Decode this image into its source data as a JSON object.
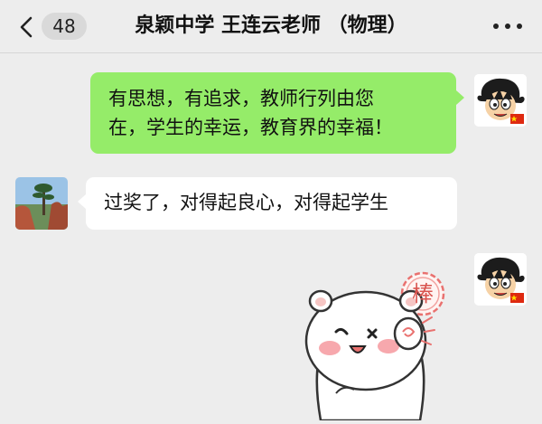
{
  "header": {
    "unread_count": "48",
    "title": "泉颖中学 王连云老师 （物理）"
  },
  "messages": [
    {
      "sender": "self",
      "lines": [
        "有思想，有追求，教师行列由您",
        "在，学生的幸运，教育界的幸福！"
      ]
    },
    {
      "sender": "other",
      "lines": [
        "过奖了，对得起良心，对得起学生"
      ]
    },
    {
      "sender": "self",
      "sticker": {
        "character": "white-bear-waving",
        "badge_text": "棒"
      }
    }
  ],
  "colors": {
    "background": "#ededed",
    "self_bubble": "#95ec69",
    "other_bubble": "#ffffff",
    "badge_accent": "#e9716f"
  }
}
